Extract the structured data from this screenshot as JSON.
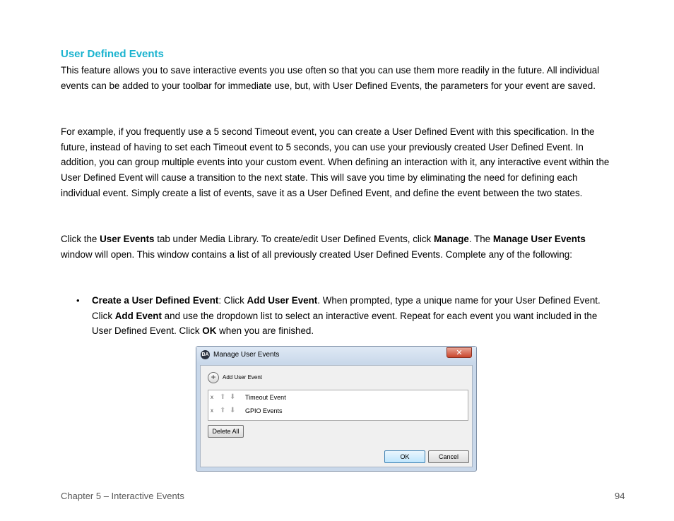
{
  "section_title": "User Defined Events",
  "para1": "This feature allows you to save interactive events you use often so that you can use them more readily in the future. All individual events can be added to your toolbar for immediate use, but, with User Defined Events, the parameters for your event are saved.",
  "para2": "For example, if you frequently use a 5 second Timeout event, you can create a User Defined Event with this specification. In the future, instead of having to set each Timeout event to 5 seconds, you can use your previously created User Defined Event. In addition, you can group multiple events into your custom event. When defining an interaction with it, any interactive event within the User Defined Event will cause a transition to the next state. This will save you time by eliminating the need for defining each individual event. Simply create a list of events, save it as a User Defined Event, and define the event between the two states.",
  "para3": {
    "t1": "Click the ",
    "b1": "User Events",
    "t2": " tab under Media Library. To create/edit User Defined Events, click ",
    "b2": "Manage",
    "t3": ". The ",
    "b3": "Manage User Events",
    "t4": " window will open. This window contains a list of all previously created User Defined Events. Complete any of the following:"
  },
  "bullet": {
    "dot": "•",
    "b1": "Create a User Defined Event",
    "t1": ": Click ",
    "b2": "Add User Event",
    "t2": ". When prompted, type a unique name for your User Defined Event. Click ",
    "b3": "Add Event",
    "t3": " and use the dropdown list to select an interactive event. Repeat for each event you want included in the User Defined Event. Click ",
    "b4": "OK",
    "t4": " when you are finished."
  },
  "dialog": {
    "icon_text": "BA",
    "title": "Manage User Events",
    "close_symbol": "✕",
    "add_symbol": "+",
    "add_label": "Add User Event",
    "events": [
      {
        "remove": "x",
        "name": "Timeout Event"
      },
      {
        "remove": "x",
        "name": "GPIO Events"
      }
    ],
    "up_arrow": "⬆",
    "down_arrow": "⬇",
    "delete_all": "Delete All",
    "ok": "OK",
    "cancel": "Cancel"
  },
  "footer": {
    "chapter": "Chapter 5 – Interactive Events",
    "page": "94"
  },
  "colors": {
    "title_accent": "#1ab3cf",
    "footer_text": "#595959"
  }
}
